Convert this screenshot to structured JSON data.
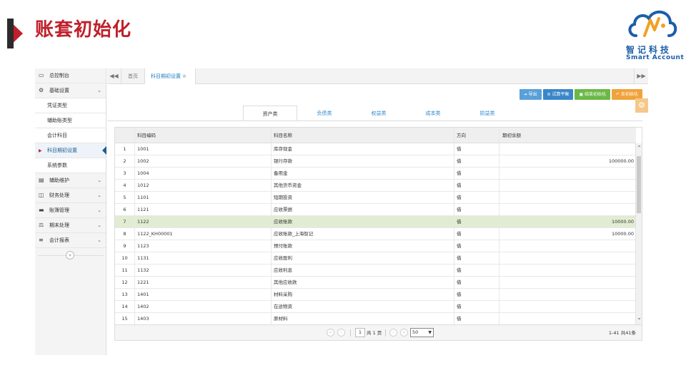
{
  "slide": {
    "title": "账套初始化"
  },
  "logo": {
    "cn": "智记科技",
    "en": "Smart Account",
    "colors": {
      "blue": "#1a5fa8",
      "orange": "#f3a021"
    }
  },
  "sidebar": {
    "items": [
      {
        "label": "总控制台",
        "icon": "monitor-icon",
        "expandable": false
      },
      {
        "label": "基础设置",
        "icon": "gears-icon",
        "expandable": true,
        "expanded": true
      },
      {
        "label": "凭证类型",
        "sub": true
      },
      {
        "label": "辅助账类型",
        "sub": true
      },
      {
        "label": "会计科目",
        "sub": true
      },
      {
        "label": "科目期初设置",
        "sub": true,
        "active": true
      },
      {
        "label": "系统参数",
        "sub": true
      },
      {
        "label": "辅助维护",
        "icon": "card-icon",
        "expandable": true
      },
      {
        "label": "财务处理",
        "icon": "finance-icon",
        "expandable": true
      },
      {
        "label": "账簿管理",
        "icon": "ledger-icon",
        "expandable": true
      },
      {
        "label": "期末处理",
        "icon": "scale-icon",
        "expandable": true
      },
      {
        "label": "会计报表",
        "icon": "report-icon",
        "expandable": true
      }
    ]
  },
  "tabbar": {
    "home": "首页",
    "active_tab": "科目期初设置"
  },
  "toolbar": {
    "buttons": [
      {
        "label": "导出",
        "icon": "export-icon",
        "color": "#5aa0d8"
      },
      {
        "label": "试算平衡",
        "icon": "balance-icon",
        "color": "#3a86c8"
      },
      {
        "label": "结束初始化",
        "icon": "finish-icon",
        "color": "#6cb845"
      },
      {
        "label": "反初始化",
        "icon": "undo-icon",
        "color": "#f0a33a"
      }
    ]
  },
  "category_tabs": [
    "资产类",
    "负债类",
    "权益类",
    "成本类",
    "损益类"
  ],
  "active_category": "资产类",
  "grid": {
    "columns": {
      "code": "科目编码",
      "name": "科目名称",
      "direction": "方向",
      "balance": "期初余额"
    },
    "rows": [
      {
        "idx": "1",
        "code": "1001",
        "name": "库存现金",
        "dir": "借",
        "bal": ""
      },
      {
        "idx": "2",
        "code": "1002",
        "name": "银行存款",
        "dir": "借",
        "bal": "100000.00"
      },
      {
        "idx": "3",
        "code": "1004",
        "name": "备用金",
        "dir": "借",
        "bal": ""
      },
      {
        "idx": "4",
        "code": "1012",
        "name": "其他货币资金",
        "dir": "借",
        "bal": ""
      },
      {
        "idx": "5",
        "code": "1101",
        "name": "短期投资",
        "dir": "借",
        "bal": ""
      },
      {
        "idx": "6",
        "code": "1121",
        "name": "应收票据",
        "dir": "借",
        "bal": ""
      },
      {
        "idx": "7",
        "code": "1122",
        "name": "应收账款",
        "dir": "借",
        "bal": "10000.00",
        "selected": true
      },
      {
        "idx": "8",
        "code": "1122_KH00001",
        "name": "应收账款_上海智记",
        "dir": "借",
        "bal": "10000.00"
      },
      {
        "idx": "9",
        "code": "1123",
        "name": "预付账款",
        "dir": "借",
        "bal": ""
      },
      {
        "idx": "10",
        "code": "1131",
        "name": "应收股利",
        "dir": "借",
        "bal": ""
      },
      {
        "idx": "11",
        "code": "1132",
        "name": "应收利息",
        "dir": "借",
        "bal": ""
      },
      {
        "idx": "12",
        "code": "1221",
        "name": "其他应收款",
        "dir": "借",
        "bal": ""
      },
      {
        "idx": "13",
        "code": "1401",
        "name": "材料采购",
        "dir": "借",
        "bal": ""
      },
      {
        "idx": "14",
        "code": "1402",
        "name": "在途物资",
        "dir": "借",
        "bal": ""
      },
      {
        "idx": "15",
        "code": "1403",
        "name": "原材料",
        "dir": "借",
        "bal": ""
      }
    ]
  },
  "pager": {
    "page": "1",
    "of_prefix": "共",
    "of_suffix": "页",
    "total_pages": "1",
    "page_size": "50",
    "summary": "1-41 共41条"
  }
}
